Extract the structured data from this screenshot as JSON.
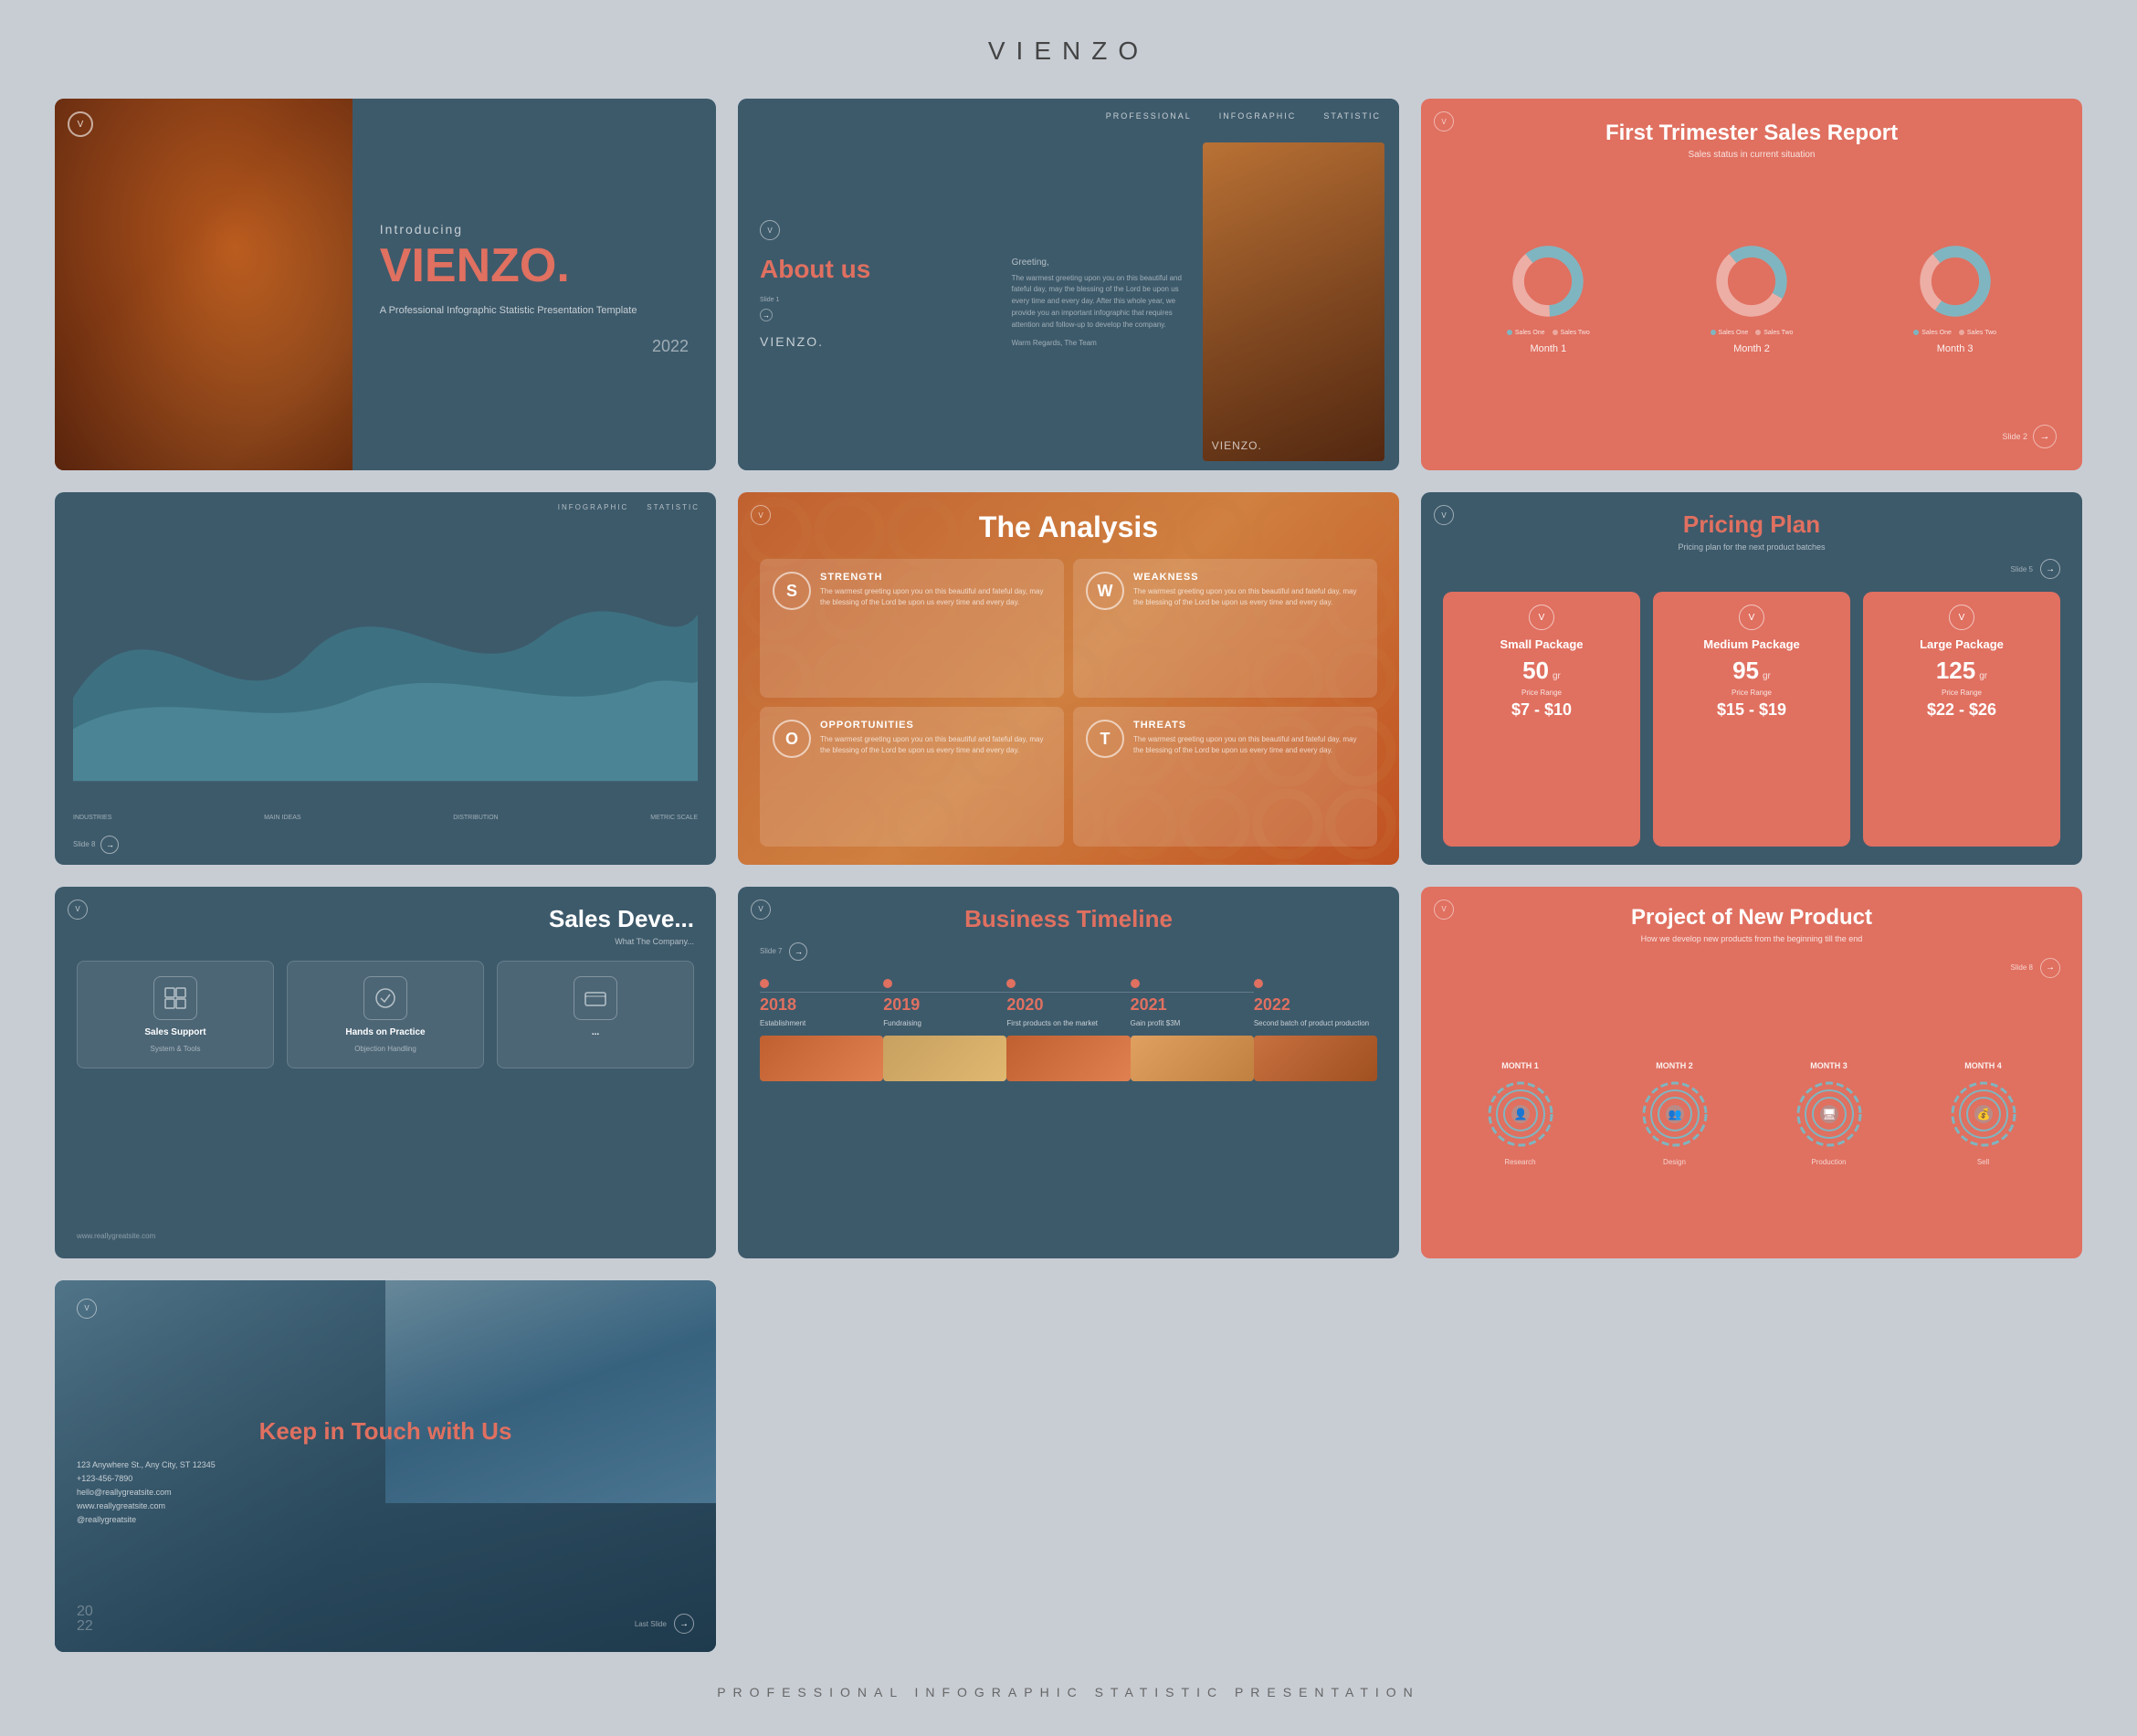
{
  "brand": {
    "name": "VIENZO",
    "tagline": "PROFESSIONAL INFOGRAPHIC STATISTIC PRESENTATION"
  },
  "slides": [
    {
      "id": 1,
      "type": "intro",
      "logo": "V",
      "main_title": "VIENZO.",
      "intro_label": "Introducing",
      "description": "A Professional Infographic Statistic Presentation Template",
      "year": "2022"
    },
    {
      "id": 2,
      "type": "about",
      "logo": "V",
      "nav_items": [
        "PROFESSIONAL",
        "INFOGRAPHIC",
        "STATISTIC"
      ],
      "title": "About us",
      "greeting": "Greeting,",
      "body_text": "The warmest greeting upon you on this beautiful and fateful day, may the blessing of the Lord be upon us every time and every day. After this whole year, we provide you an important infographic that requires attention and follow-up to develop the company.",
      "sign_off": "Warm Regards,\nThe Team",
      "slide_label": "Slide 1",
      "slide_logo": "VIENZO."
    },
    {
      "id": 3,
      "type": "sales_report",
      "logo": "V",
      "title": "First Trimester Sales Report",
      "subtitle": "Sales status in current situation",
      "months": [
        "Month 1",
        "Month 2",
        "Month 3"
      ],
      "legend": [
        "Sales One",
        "Sales Two"
      ],
      "colors": {
        "sales_one": "#7fb5c0",
        "sales_two": "#e07060"
      },
      "slide_label": "Slide 2"
    },
    {
      "id": 4,
      "type": "infographic",
      "nav_items": [
        "INFOGRAPHIC",
        "STATISTIC"
      ],
      "bottom_labels": [
        "INDUSTRIES",
        "MAIN IDEAS",
        "DISTRIBUTION",
        "METRIC SCALE"
      ],
      "slide_label": "Slide 8"
    },
    {
      "id": 5,
      "type": "analysis",
      "logo": "V",
      "title": "The Analysis",
      "swot": [
        {
          "letter": "S",
          "heading": "STRENGTH",
          "text": "The warmest greeting upon you on this beautiful and fateful day, may the blessing of the Lord be upon us every time and every day."
        },
        {
          "letter": "W",
          "heading": "WEAKNESS",
          "text": "The warmest greeting upon you on this beautiful and fateful day, may the blessing of the Lord be upon us every time and every day."
        },
        {
          "letter": "O",
          "heading": "OPPORTUNITIES",
          "text": "The warmest greeting upon you on this beautiful and fateful day, may the blessing of the Lord be upon us every time and every day."
        },
        {
          "letter": "T",
          "heading": "THREATS",
          "text": "The warmest greeting upon you on this beautiful and fateful day, may the blessing of the Lord be upon us every time and every day."
        }
      ]
    },
    {
      "id": 6,
      "type": "pricing",
      "logo": "V",
      "title": "Pricing Plan",
      "subtitle": "Pricing plan for the next product batches",
      "slide_label": "Slide 5",
      "packages": [
        {
          "name": "Small Package",
          "amount": "50",
          "unit": "gr",
          "price_range_label": "Price Range",
          "price": "$7 - $10"
        },
        {
          "name": "Medium Package",
          "amount": "95",
          "unit": "gr",
          "price_range_label": "Price Range",
          "price": "$15 - $19"
        },
        {
          "name": "Large Package",
          "amount": "125",
          "unit": "gr",
          "price_range_label": "Price Range",
          "price": "$22 - $26"
        }
      ]
    },
    {
      "id": 7,
      "type": "sales_dev",
      "logo": "V",
      "title": "Sales Deve...",
      "subtitle": "What The Company...",
      "cards": [
        {
          "icon": "📊",
          "title": "Sales Support",
          "sub": "System & Tools"
        },
        {
          "icon": "🎯",
          "title": "Hands on Practice",
          "sub": "Objection Handling"
        },
        {
          "icon": "📈",
          "title": "...",
          "sub": ""
        }
      ],
      "website": "www.reallygreatsite.com"
    },
    {
      "id": 8,
      "type": "timeline",
      "logo": "V",
      "title": "Business Timeline",
      "slide_label": "Slide 7",
      "timeline": [
        {
          "year": "2018",
          "event": "Establishment"
        },
        {
          "year": "2019",
          "event": "Fundraising"
        },
        {
          "year": "2020",
          "event": "First products on the market"
        },
        {
          "year": "2021",
          "event": "Gain profit $3M"
        },
        {
          "year": "2022",
          "event": "Second batch of product production"
        }
      ]
    },
    {
      "id": 9,
      "type": "project",
      "logo": "V",
      "title": "Project of New Product",
      "subtitle": "How we develop new products from the beginning till the end",
      "slide_label": "Slide 8",
      "months": [
        {
          "label": "MONTH 1",
          "sublabel": "Research"
        },
        {
          "label": "MONTH 2",
          "sublabel": "Design"
        },
        {
          "label": "MONTH 3",
          "sublabel": "Production"
        },
        {
          "label": "MONTH 4",
          "sublabel": "Sell"
        }
      ]
    },
    {
      "id": 10,
      "type": "contact",
      "logo": "V",
      "title": "Keep in Touch with Us",
      "address": "123 Anywhere St., Any City, ST 12345",
      "phone": "+123-456-7890",
      "email1": "hello@reallygreatsite.com",
      "website": "www.reallygreatsite.com",
      "social": "@reallygreatsite",
      "slide_label": "Last Slide",
      "year": "20\n22"
    }
  ]
}
